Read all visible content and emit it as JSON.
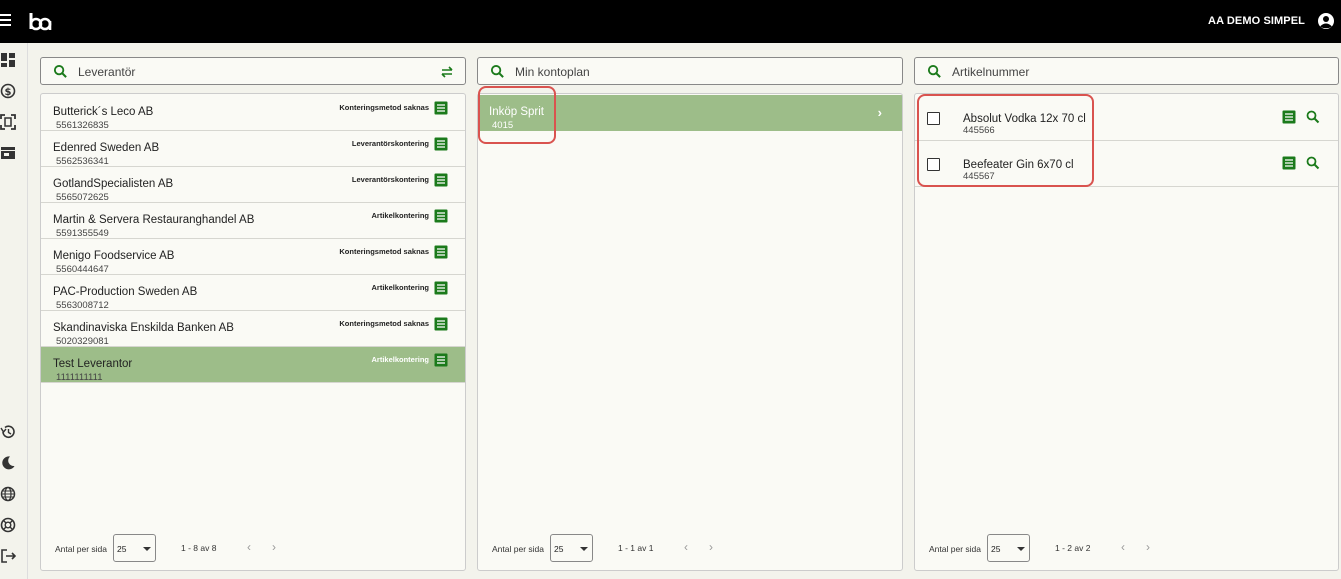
{
  "topbar": {
    "user_name": "AA DEMO SIMPEL"
  },
  "rail": {
    "icons": [
      "dashboard-icon",
      "finance-icon",
      "scan-icon",
      "store-icon",
      "history-icon",
      "moon-icon",
      "globe-icon",
      "support-icon",
      "logout-icon"
    ]
  },
  "suppliers": {
    "search_placeholder": "Leverantör",
    "rows": [
      {
        "name": "Butterick´s Leco AB",
        "number": "5561326835",
        "method": "Konteringsmetod saknas"
      },
      {
        "name": "Edenred Sweden AB",
        "number": "5562536341",
        "method": "Leverantörskontering"
      },
      {
        "name": "GotlandSpecialisten AB",
        "number": "5565072625",
        "method": "Leverantörskontering"
      },
      {
        "name": "Martin & Servera Restauranghandel AB",
        "number": "5591355549",
        "method": "Artikelkontering"
      },
      {
        "name": "Menigo Foodservice AB",
        "number": "5560444647",
        "method": "Konteringsmetod saknas"
      },
      {
        "name": "PAC-Production Sweden AB",
        "number": "5563008712",
        "method": "Artikelkontering"
      },
      {
        "name": "Skandinaviska Enskilda Banken AB",
        "number": "5020329081",
        "method": "Konteringsmetod saknas"
      },
      {
        "name": "Test Leverantor",
        "number": "1111111111",
        "method": "Artikelkontering"
      }
    ],
    "footer": {
      "per_page_label": "Antal per sida",
      "per_page_value": "25",
      "range": "1 - 8 av 8"
    }
  },
  "kontoplan": {
    "search_placeholder": "Min kontoplan",
    "rows": [
      {
        "name": "Inköp Sprit",
        "number": "4015"
      }
    ],
    "footer": {
      "per_page_label": "Antal per sida",
      "per_page_value": "25",
      "range": "1 - 1 av 1"
    }
  },
  "articles": {
    "search_placeholder": "Artikelnummer",
    "rows": [
      {
        "name": "Absolut Vodka 12x 70 cl",
        "number": "445566"
      },
      {
        "name": "Beefeater Gin 6x70 cl",
        "number": "445567"
      }
    ],
    "footer": {
      "per_page_label": "Antal per sida",
      "per_page_value": "25",
      "range": "1 - 2 av 2"
    }
  },
  "colors": {
    "accent_green": "#1b7a1b",
    "selected_row": "#9dbd89",
    "highlight": "#d9534f"
  }
}
